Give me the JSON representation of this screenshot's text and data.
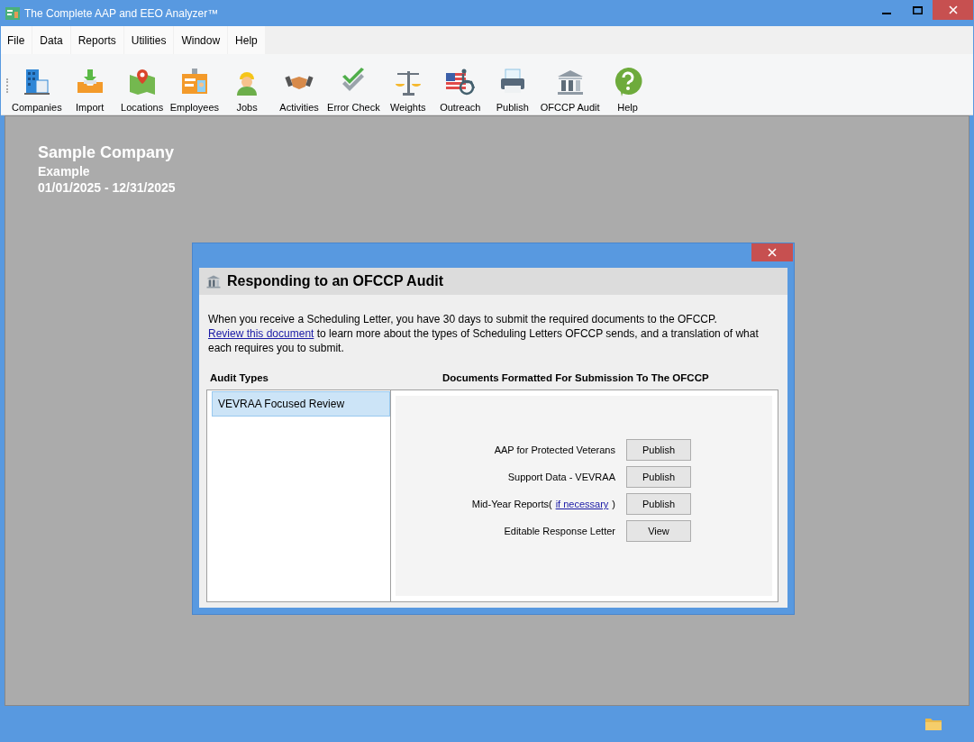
{
  "window": {
    "title": "The Complete AAP and EEO Analyzer™"
  },
  "menu": [
    "File",
    "Data",
    "Reports",
    "Utilities",
    "Window",
    "Help"
  ],
  "toolbar": [
    "Companies",
    "Import",
    "Locations",
    "Employees",
    "Jobs",
    "Activities",
    "Error Check",
    "Weights",
    "Outreach",
    "Publish",
    "OFCCP Audit",
    "Help"
  ],
  "company": {
    "name": "Sample Company",
    "subtitle": "Example",
    "period": "01/01/2025 - 12/31/2025"
  },
  "dialog": {
    "title": "Responding to an OFCCP Audit",
    "intro": {
      "sentence": "When you receive a Scheduling Letter, you have 30 days to submit the required documents to the OFCCP.",
      "link": "Review this document",
      "rest": "to learn more about the types of Scheduling Letters OFCCP sends, and a translation of what each requires you to submit."
    },
    "audit_types_heading": "Audit Types",
    "documents_heading": "Documents Formatted For Submission To The OFCCP",
    "audit_types": [
      {
        "label": "VEVRAA Focused Review",
        "selected": true
      }
    ],
    "documents": [
      {
        "label": "AAP for Protected Veterans",
        "button": "Publish"
      },
      {
        "label": "Support Data - VEVRAA",
        "button": "Publish"
      },
      {
        "label": "Mid-Year Reports(",
        "link": "if necessary",
        "after": ")",
        "button": "Publish"
      },
      {
        "label": "Editable Response Letter",
        "button": "View"
      }
    ]
  }
}
